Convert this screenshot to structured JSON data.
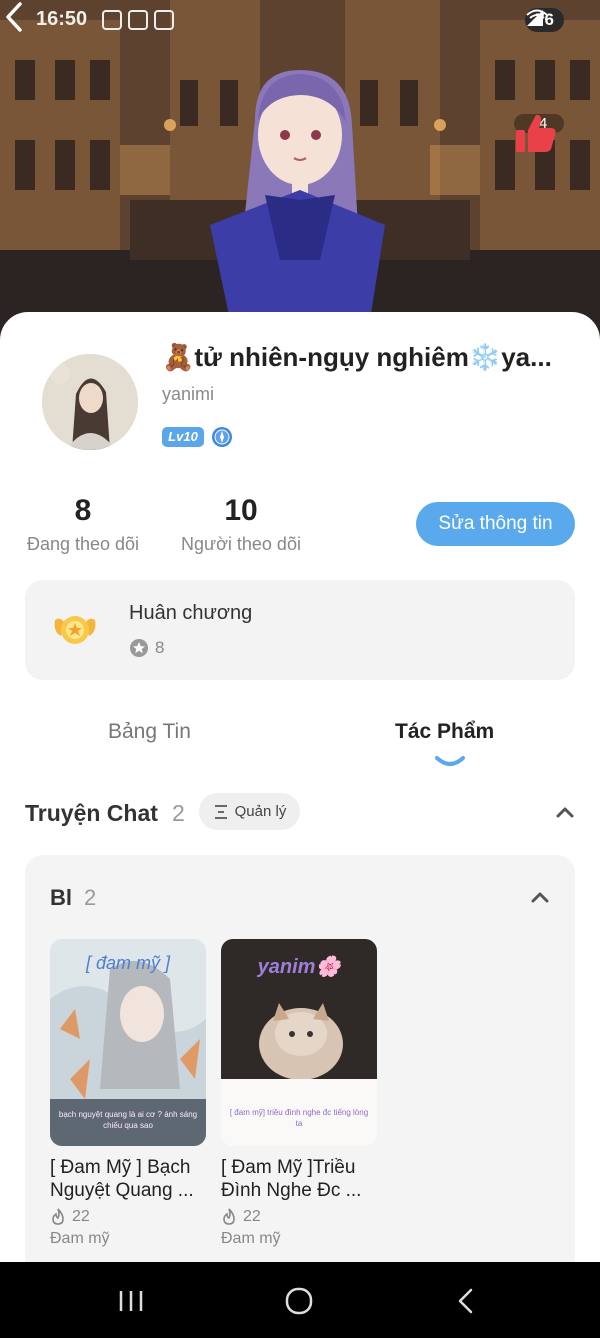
{
  "status_bar": {
    "time": "16:50",
    "battery": "76"
  },
  "header": {
    "likes": "44"
  },
  "profile": {
    "display_name": "🧸tử nhiên-ngụy nghiêm❄️ya...",
    "username": "yanimi",
    "level_badge": "Lv10"
  },
  "stats": {
    "following_count": "8",
    "following_label": "Đang theo dõi",
    "followers_count": "10",
    "followers_label": "Người theo dõi"
  },
  "edit_button": "Sửa thông tin",
  "medals": {
    "title": "Huân chương",
    "count": "8"
  },
  "tabs": [
    {
      "label": "Bảng Tin",
      "active": false
    },
    {
      "label": "Tác Phẩm",
      "active": true
    }
  ],
  "chat_stories": {
    "title": "Truyện Chat",
    "count": "2",
    "manage_label": "Quản lý",
    "group": {
      "title": "Bl",
      "count": "2",
      "items": [
        {
          "title": "[ Đam Mỹ ] Bạch Nguyệt Quang ...",
          "reads": "22",
          "genre": "Đam mỹ",
          "cover_heading": "[ đam mỹ ]",
          "cover_caption": "bạch nguyệt quang là ai cơ ? ánh sáng chiếu qua sao"
        },
        {
          "title": "[ Đam Mỹ ]Triều Đình Nghe Đc ...",
          "reads": "22",
          "genre": "Đam mỹ",
          "cover_heading": "yanim🌸",
          "cover_caption": "[ đam mỹ] triều đình nghe đc tiếng lòng ta"
        }
      ]
    }
  },
  "colors": {
    "accent": "#5aa9ed",
    "like": "#e9404a",
    "background": "#ffffff"
  }
}
